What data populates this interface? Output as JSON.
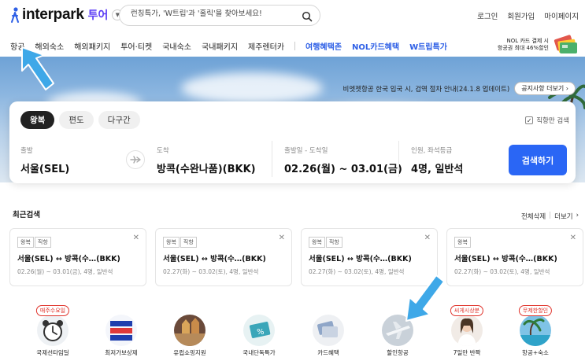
{
  "header": {
    "logo_text": "interpark",
    "logo_sub": "투어",
    "search_placeholder": "런칭특가, 'W트립'과 '홀릭'을 찾아보세요!",
    "links": [
      "로그인",
      "회원가입",
      "마이페이지"
    ]
  },
  "nav": {
    "items": [
      "항공",
      "해외숙소",
      "해외패키지",
      "투어·티켓",
      "국내숙소",
      "국내패키지",
      "제주렌터카"
    ],
    "promo_items": [
      "여행혜택존",
      "NOL카드혜택",
      "W트립특가"
    ],
    "banner_line1": "NOL 카드 결제 시",
    "banner_line2": "항공권 최대 46%할인"
  },
  "hero": {
    "notice": "비엣젯항공 한국 입국 시, 검역 절차 안내(24.1.8 업데이트)",
    "notice_button": "공지사항 더보기 ›"
  },
  "search_panel": {
    "trip_tabs": [
      "왕복",
      "편도",
      "다구간"
    ],
    "active_tab": "왕복",
    "direct_only": "직항만 검색",
    "fields": [
      {
        "label": "출발",
        "value": "서울(SEL)"
      },
      {
        "label": "도착",
        "value": "방콕(수완나품)(BKK)"
      },
      {
        "label": "출발일 - 도착일",
        "value": "02.26(월) ~ 03.01(금)"
      },
      {
        "label": "인원, 좌석등급",
        "value": "4명, 일반석"
      }
    ],
    "search_button": "검색하기"
  },
  "recent": {
    "title": "최근검색",
    "delete_all": "전체삭제",
    "more": "더보기",
    "cards": [
      {
        "tags": [
          "왕복",
          "직항"
        ],
        "route": "서울(SEL)  ↔ 방콕(수…(BKK)",
        "detail": "02.26(월) ~ 03.01(금),  4명,  일반석"
      },
      {
        "tags": [
          "왕복",
          "직항"
        ],
        "route": "서울(SEL)  ↔ 방콕(수…(BKK)",
        "detail": "02.27(화) ~ 03.02(토),  4명,  일반석"
      },
      {
        "tags": [
          "왕복",
          "직항"
        ],
        "route": "서울(SEL)  ↔ 방콕(수…(BKK)",
        "detail": "02.27(화) ~ 03.02(토),  4명,  일반석"
      },
      {
        "tags": [
          "왕복"
        ],
        "route": "서울(SEL)  ↔ 방콕(수…(BKK)",
        "detail": "02.27(화) ~ 03.02(토),  4명,  일반석"
      }
    ]
  },
  "categories": [
    {
      "label": "국제선타임딜",
      "badge": "매주수요일",
      "icon": "alarm-clock-icon"
    },
    {
      "label": "최저가보상제",
      "badge": "",
      "icon": "lowest-price-icon"
    },
    {
      "label": "유럽쇼핑지원",
      "badge": "",
      "icon": "europe-shopping-icon"
    },
    {
      "label": "국내단독특가",
      "badge": "",
      "icon": "domestic-deal-icon"
    },
    {
      "label": "카드혜택",
      "badge": "",
      "icon": "card-benefit-icon"
    },
    {
      "label": "할인항공",
      "badge": "",
      "icon": "airplane-icon"
    },
    {
      "label": "7일만 반짝",
      "badge": "씨게시상분",
      "icon": "flash-sale-icon"
    },
    {
      "label": "항공+숙소",
      "badge": "무제한할인",
      "icon": "air-hotel-icon"
    }
  ],
  "colors": {
    "accent": "#2a66f5",
    "brand_purple": "#5b3df5",
    "nav_promo": "#2f60e6",
    "badge_red": "#e0332b",
    "annotation_arrow": "#3ea8e8"
  }
}
